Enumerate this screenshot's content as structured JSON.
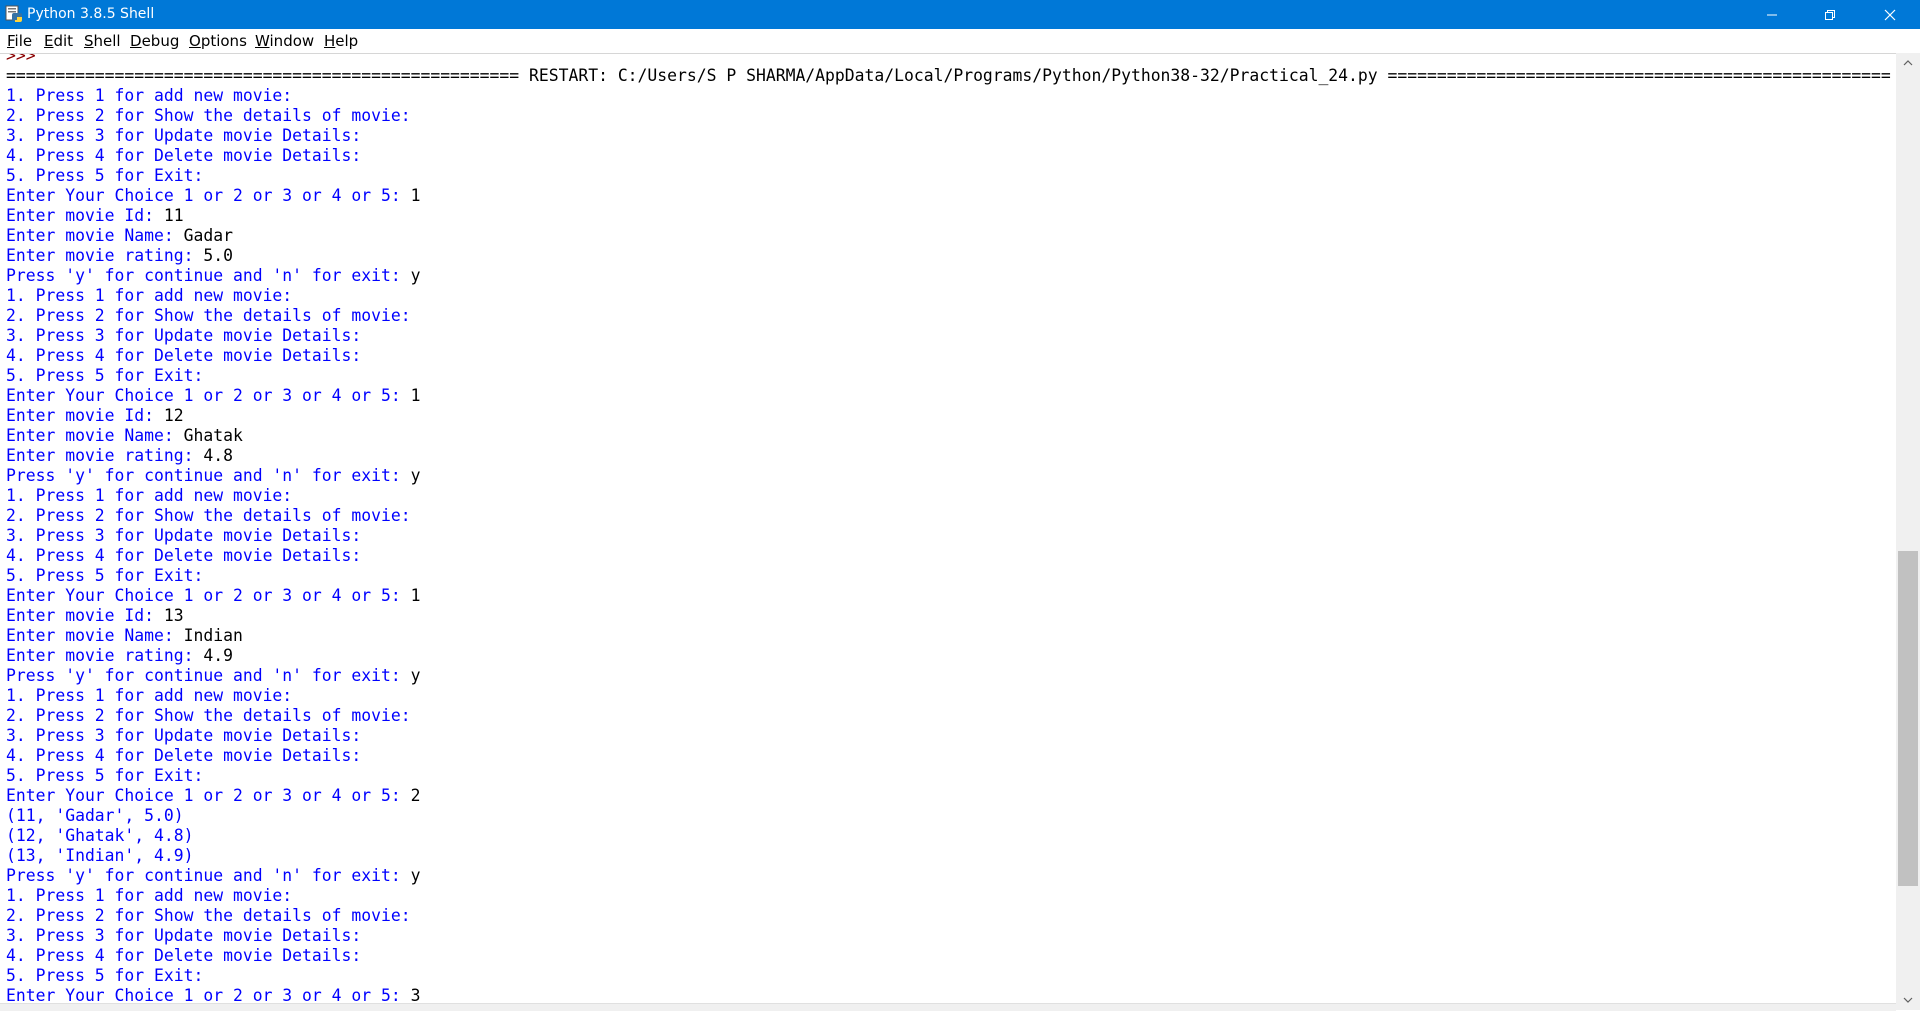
{
  "window": {
    "title": "Python 3.8.5 Shell",
    "accent": "#0078d7",
    "icons": [
      "python-icon",
      "minimize-icon",
      "maximize-icon",
      "close-icon"
    ]
  },
  "menu": [
    "File",
    "Edit",
    "Shell",
    "Debug",
    "Options",
    "Window",
    "Help"
  ],
  "colors": {
    "output": "#0000ff",
    "input": "#000000",
    "prompt": "#8b0000"
  },
  "shell": {
    "lines": [
      {
        "t": ">>> ",
        "k": "prompt"
      },
      {
        "t": "==================================================== RESTART: C:/Users/S P SHARMA/AppData/Local/Programs/Python/Python38-32/Practical_24.py ===================================================",
        "k": "restart"
      },
      {
        "t": "1. Press 1 for add new movie:",
        "k": "out"
      },
      {
        "t": "2. Press 2 for Show the details of movie:",
        "k": "out"
      },
      {
        "t": "3. Press 3 for Update movie Details:",
        "k": "out"
      },
      {
        "t": "4. Press 4 for Delete movie Details:",
        "k": "out"
      },
      {
        "t": "5. Press 5 for Exit:",
        "k": "out"
      },
      {
        "t": "Enter Your Choice 1 or 2 or 3 or 4 or 5: ",
        "k": "out",
        "i": "1"
      },
      {
        "t": "Enter movie Id: ",
        "k": "out",
        "i": "11"
      },
      {
        "t": "Enter movie Name: ",
        "k": "out",
        "i": "Gadar"
      },
      {
        "t": "Enter movie rating: ",
        "k": "out",
        "i": "5.0"
      },
      {
        "t": "Press 'y' for continue and 'n' for exit: ",
        "k": "out",
        "i": "y"
      },
      {
        "t": "1. Press 1 for add new movie:",
        "k": "out"
      },
      {
        "t": "2. Press 2 for Show the details of movie:",
        "k": "out"
      },
      {
        "t": "3. Press 3 for Update movie Details:",
        "k": "out"
      },
      {
        "t": "4. Press 4 for Delete movie Details:",
        "k": "out"
      },
      {
        "t": "5. Press 5 for Exit:",
        "k": "out"
      },
      {
        "t": "Enter Your Choice 1 or 2 or 3 or 4 or 5: ",
        "k": "out",
        "i": "1"
      },
      {
        "t": "Enter movie Id: ",
        "k": "out",
        "i": "12"
      },
      {
        "t": "Enter movie Name: ",
        "k": "out",
        "i": "Ghatak"
      },
      {
        "t": "Enter movie rating: ",
        "k": "out",
        "i": "4.8"
      },
      {
        "t": "Press 'y' for continue and 'n' for exit: ",
        "k": "out",
        "i": "y"
      },
      {
        "t": "1. Press 1 for add new movie:",
        "k": "out"
      },
      {
        "t": "2. Press 2 for Show the details of movie:",
        "k": "out"
      },
      {
        "t": "3. Press 3 for Update movie Details:",
        "k": "out"
      },
      {
        "t": "4. Press 4 for Delete movie Details:",
        "k": "out"
      },
      {
        "t": "5. Press 5 for Exit:",
        "k": "out"
      },
      {
        "t": "Enter Your Choice 1 or 2 or 3 or 4 or 5: ",
        "k": "out",
        "i": "1"
      },
      {
        "t": "Enter movie Id: ",
        "k": "out",
        "i": "13"
      },
      {
        "t": "Enter movie Name: ",
        "k": "out",
        "i": "Indian"
      },
      {
        "t": "Enter movie rating: ",
        "k": "out",
        "i": "4.9"
      },
      {
        "t": "Press 'y' for continue and 'n' for exit: ",
        "k": "out",
        "i": "y"
      },
      {
        "t": "1. Press 1 for add new movie:",
        "k": "out"
      },
      {
        "t": "2. Press 2 for Show the details of movie:",
        "k": "out"
      },
      {
        "t": "3. Press 3 for Update movie Details:",
        "k": "out"
      },
      {
        "t": "4. Press 4 for Delete movie Details:",
        "k": "out"
      },
      {
        "t": "5. Press 5 for Exit:",
        "k": "out"
      },
      {
        "t": "Enter Your Choice 1 or 2 or 3 or 4 or 5: ",
        "k": "out",
        "i": "2"
      },
      {
        "t": "(11, 'Gadar', 5.0)",
        "k": "out"
      },
      {
        "t": "(12, 'Ghatak', 4.8)",
        "k": "out"
      },
      {
        "t": "(13, 'Indian', 4.9)",
        "k": "out"
      },
      {
        "t": "Press 'y' for continue and 'n' for exit: ",
        "k": "out",
        "i": "y"
      },
      {
        "t": "1. Press 1 for add new movie:",
        "k": "out"
      },
      {
        "t": "2. Press 2 for Show the details of movie:",
        "k": "out"
      },
      {
        "t": "3. Press 3 for Update movie Details:",
        "k": "out"
      },
      {
        "t": "4. Press 4 for Delete movie Details:",
        "k": "out"
      },
      {
        "t": "5. Press 5 for Exit:",
        "k": "out"
      },
      {
        "t": "Enter Your Choice 1 or 2 or 3 or 4 or 5: ",
        "k": "out",
        "i": "3"
      }
    ]
  }
}
